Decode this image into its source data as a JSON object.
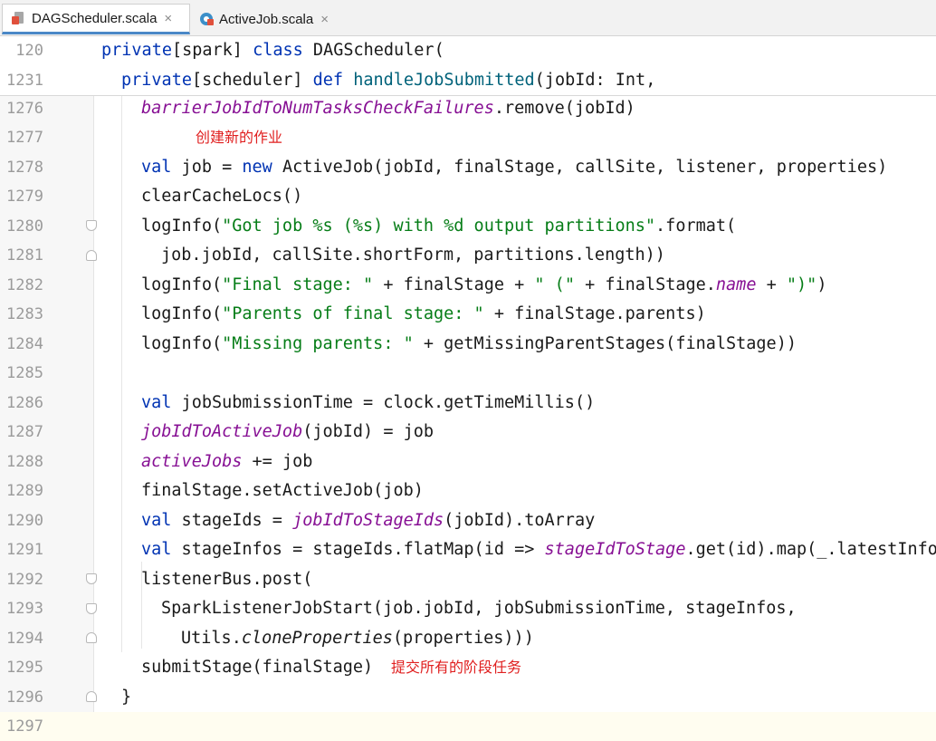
{
  "tabs": [
    {
      "label": "DAGScheduler.scala",
      "close": "×",
      "icon": "scala-file-icon"
    },
    {
      "label": "ActiveJob.scala",
      "close": "×",
      "icon": "scala-class-icon"
    }
  ],
  "sticky": [
    {
      "num": "120",
      "text": "private[spark] class DAGScheduler("
    },
    {
      "num": "1231",
      "text": "private[scheduler] def handleJobSubmitted(jobId: Int,"
    }
  ],
  "lines": {
    "l1276": {
      "num": "1276"
    },
    "l1277": {
      "num": "1277"
    },
    "l1278": {
      "num": "1278"
    },
    "l1279": {
      "num": "1279"
    },
    "l1280": {
      "num": "1280"
    },
    "l1281": {
      "num": "1281"
    },
    "l1282": {
      "num": "1282"
    },
    "l1283": {
      "num": "1283"
    },
    "l1284": {
      "num": "1284"
    },
    "l1285": {
      "num": "1285"
    },
    "l1286": {
      "num": "1286"
    },
    "l1287": {
      "num": "1287"
    },
    "l1288": {
      "num": "1288"
    },
    "l1289": {
      "num": "1289"
    },
    "l1290": {
      "num": "1290"
    },
    "l1291": {
      "num": "1291"
    },
    "l1292": {
      "num": "1292"
    },
    "l1293": {
      "num": "1293"
    },
    "l1294": {
      "num": "1294"
    },
    "l1295": {
      "num": "1295"
    },
    "l1296": {
      "num": "1296"
    },
    "l1297": {
      "num": "1297"
    }
  },
  "code": {
    "c1276a": "barrierJobIdToNumTasksCheckFailures",
    "c1276b": ".remove(jobId)",
    "c1278a": "val",
    "c1278b": " job = ",
    "c1278c": "new",
    "c1278d": " ActiveJob(jobId, finalStage, callSite, listener, properties)",
    "c1279": "clearCacheLocs()",
    "c1280a": "logInfo(",
    "c1280b": "\"Got job %s (%s) with %d output partitions\"",
    "c1280c": ".format(",
    "c1281": "job.jobId, callSite.shortForm, partitions.length))",
    "c1282a": "logInfo(",
    "c1282b": "\"Final stage: \"",
    "c1282c": " + finalStage + ",
    "c1282d": "\" (\"",
    "c1282e": " + finalStage.",
    "c1282f": "name",
    "c1282g": " + ",
    "c1282h": "\")\"",
    "c1282i": ")",
    "c1283a": "logInfo(",
    "c1283b": "\"Parents of final stage: \"",
    "c1283c": " + finalStage.parents)",
    "c1284a": "logInfo(",
    "c1284b": "\"Missing parents: \"",
    "c1284c": " + getMissingParentStages(finalStage))",
    "c1286a": "val",
    "c1286b": " jobSubmissionTime = clock.getTimeMillis()",
    "c1287a": "jobIdToActiveJob",
    "c1287b": "(jobId) = job",
    "c1288a": "activeJobs",
    "c1288b": " += job",
    "c1289": "finalStage.setActiveJob(job)",
    "c1290a": "val",
    "c1290b": " stageIds = ",
    "c1290c": "jobIdToStageIds",
    "c1290d": "(jobId).toArray",
    "c1291a": "val",
    "c1291b": " stageInfos = stageIds.flatMap(id => ",
    "c1291c": "stageIdToStage",
    "c1291d": ".get(id).map(_.latestInfo))",
    "c1292": "listenerBus.post(",
    "c1293": "SparkListenerJobStart(job.jobId, jobSubmissionTime, stageInfos,",
    "c1294a": "Utils.",
    "c1294b": "cloneProperties",
    "c1294c": "(properties)))",
    "c1295": "submitStage(finalStage)",
    "c1296": "}"
  },
  "annotations": {
    "create_job": "创建新的作业",
    "submit_stages": "提交所有的阶段任务"
  },
  "colors": {
    "keyword": "#0033b3",
    "string": "#067d17",
    "field": "#871094",
    "annotation": "#e02020"
  }
}
